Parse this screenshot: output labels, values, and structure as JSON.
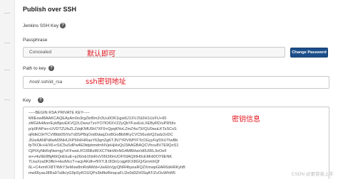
{
  "header": {
    "title": "Publish over SSH"
  },
  "jenkins_key": {
    "label": "Jenkins SSH Key"
  },
  "passphrase": {
    "label": "Passphrase",
    "value": "Concealed",
    "change_button": "Change Password",
    "annotation": "默认即可"
  },
  "path_to_key": {
    "label": "Path to key",
    "value": "/root/.ssh/id_rsa",
    "annotation": "ssh密钥地址"
  },
  "key": {
    "label": "Key",
    "annotation": "密钥信息",
    "lines": [
      "-----BEGIN RSA PRIVATE KEY-----",
      "MIIEowIBAAKCAQEAyAm0o3rgZkrBm2r3Uu0OK1igst6J1XVJSt2H1UzFU+60",
      "zMGIA4AnrrEykBjevEKVQ2LDwszTzoYO7lO6XVZZyQbYFavEsLXEByRD/uPR5tIx",
      "p/p0FAPsn+UVDTZUfsZLZdqKNfU5H7XF9+QpqKNvLZmZ4a73//QU0wuLKTsSCsS",
      "qRdkCtHTCVIBbb05iYaTd3SPBqOod0daqZxxBGoBbMKyCVC56urb/Q2adz2vDC",
      "JIUeAANPd6wM3NHUXP564/HRasY63qrtZgKTJN7YRVWfYFTcOGyyFq/0XUTIwBb",
      "fpTKOk+H/X6+rSiC5uSdPw4E0tdpbmdmNVjeHjHvQtJ3AAGBAQCVhcu8V7E9QnS1",
      "CjPtXyNkRqNwmjg7vFFwwLf/O35BslR/XCTfdnWnNG4MBHwr/d0UIRL3nOeF",
      "w+v4uNE8BjA6tQnEkuE+p26mb1NnRxV05I3I0nUOF59AQIIIH0cEMrd0OY9ENK",
      "7LkaXza0K9fbI+HezMccT+acjrAKdh+ff/XYJL0lI3n1cqgKKX8GQ/GmmhQf",
      "6L+C4vmKX8T/WkY3eMxw8mRdAWd+UwEbVgyQNR4byeaRQZXmwpGlAR6dHRKyhB",
      "mw66yasJ8Ra97a9k/yG9pSyKOUQPs3bIfkdNnqcaFLDo0d3Zt/0SqAT/ZvOuWhW6"
    ]
  },
  "watermark": "CSDN @更容易上手"
}
